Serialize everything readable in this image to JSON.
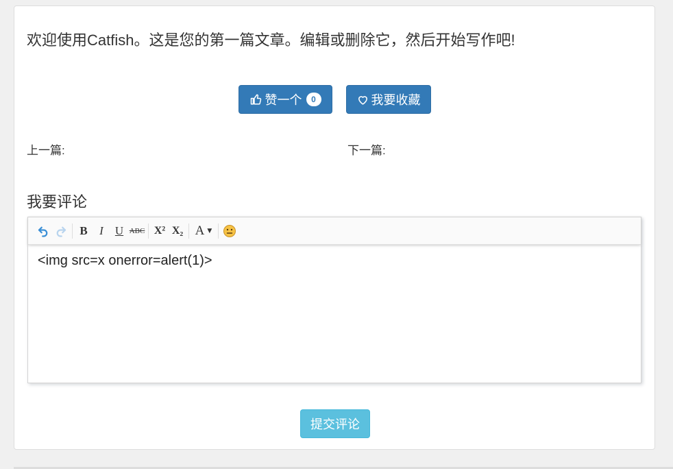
{
  "article": {
    "welcome_text": "欢迎使用Catfish。这是您的第一篇文章。编辑或删除它，然后开始写作吧!"
  },
  "actions": {
    "like_label": "赞一个",
    "like_count": "0",
    "favorite_label": "我要收藏"
  },
  "navigation": {
    "prev_label": "上一篇:",
    "next_label": "下一篇:"
  },
  "comment": {
    "heading": "我要评论",
    "toolbar": [
      {
        "name": "undo-icon"
      },
      {
        "name": "redo-icon"
      },
      {
        "name": "bold-icon",
        "glyph": "B"
      },
      {
        "name": "italic-icon",
        "glyph": "I"
      },
      {
        "name": "underline-icon",
        "glyph": "U"
      },
      {
        "name": "strikethrough-icon",
        "glyph": "ABC"
      },
      {
        "name": "superscript-icon",
        "glyph": "X²"
      },
      {
        "name": "subscript-icon",
        "glyph": "X₂"
      },
      {
        "name": "font-color-icon",
        "glyph": "A"
      },
      {
        "name": "emoticon-icon"
      }
    ],
    "editor_content": "<img src=x  onerror=alert(1)>",
    "submit_label": "提交评论"
  },
  "colors": {
    "primary": "#337ab7",
    "info": "#5bc0de"
  }
}
